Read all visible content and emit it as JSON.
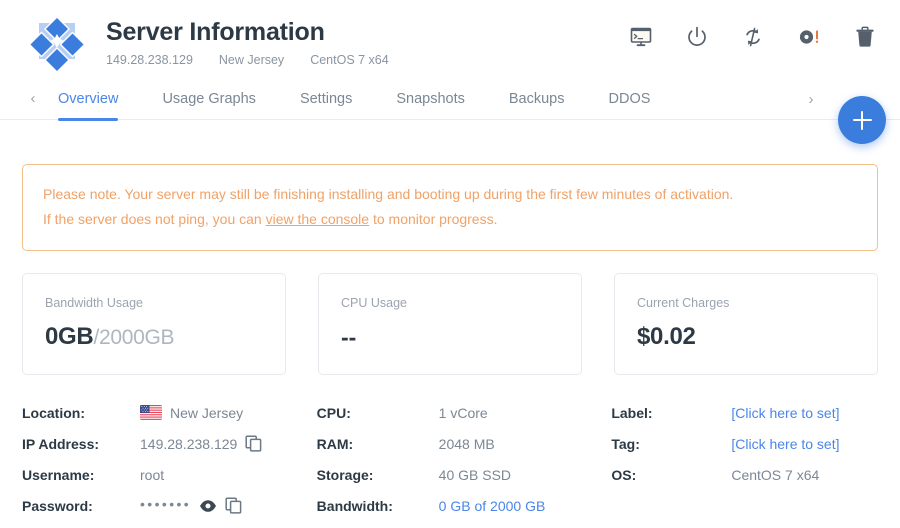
{
  "header": {
    "title": "Server Information",
    "logo_icon": "centos-logo-icon",
    "subtitle": {
      "ip": "149.28.238.129",
      "location": "New Jersey",
      "os": "CentOS 7 x64"
    },
    "actions": [
      {
        "name": "console-icon",
        "label": "View Console"
      },
      {
        "name": "power-icon",
        "label": "Power"
      },
      {
        "name": "restart-icon",
        "label": "Restart"
      },
      {
        "name": "reinstall-disk-icon",
        "label": "Reinstall"
      },
      {
        "name": "delete-trash-icon",
        "label": "Destroy"
      }
    ]
  },
  "tabs": {
    "prev_arrow": "‹",
    "next_arrow": "›",
    "items": [
      {
        "label": "Overview",
        "active": true
      },
      {
        "label": "Usage Graphs",
        "active": false
      },
      {
        "label": "Settings",
        "active": false
      },
      {
        "label": "Snapshots",
        "active": false
      },
      {
        "label": "Backups",
        "active": false
      },
      {
        "label": "DDOS",
        "active": false
      }
    ]
  },
  "fab": {
    "label": "+",
    "name": "deploy-new-server-button"
  },
  "notice": {
    "line1": "Please note. Your server may still be finishing installing and booting up during the first few minutes of activation.",
    "line2_before": "If the server does not ping, you can ",
    "line2_link": "view the console",
    "line2_after": " to monitor progress."
  },
  "cards": [
    {
      "label": "Bandwidth Usage",
      "value": "0GB",
      "value_suffix": "/2000GB"
    },
    {
      "label": "CPU Usage",
      "value": "--",
      "value_suffix": ""
    },
    {
      "label": "Current Charges",
      "value": "$0.02",
      "value_suffix": ""
    }
  ],
  "details": {
    "col1": [
      {
        "key": "Location:",
        "value": "New Jersey",
        "icon": "us-flag-icon"
      },
      {
        "key": "IP Address:",
        "value": "149.28.238.129",
        "icon": "copy-icon"
      },
      {
        "key": "Username:",
        "value": "root"
      },
      {
        "key": "Password:",
        "value": "•••••••",
        "icon": "eye-icon",
        "icon2": "copy-icon"
      }
    ],
    "col2": [
      {
        "key": "CPU:",
        "value": "1 vCore"
      },
      {
        "key": "RAM:",
        "value": "2048 MB"
      },
      {
        "key": "Storage:",
        "value": "40 GB SSD"
      },
      {
        "key": "Bandwidth:",
        "value": "0 GB of 2000 GB",
        "link": true
      }
    ],
    "col3": [
      {
        "key": "Label:",
        "value": "[Click here to set]",
        "link": true
      },
      {
        "key": "Tag:",
        "value": "[Click here to set]",
        "link": true
      },
      {
        "key": "OS:",
        "value": "CentOS 7 x64"
      }
    ]
  },
  "colors": {
    "accent_blue": "#4a86e8",
    "fab_blue": "#3b7ddd",
    "notice_orange": "#f0a268",
    "notice_border": "#f6c08a",
    "text_dark": "#2d3a45",
    "text_muted": "#7b8794",
    "logo_blue": "#3b7ddd"
  }
}
